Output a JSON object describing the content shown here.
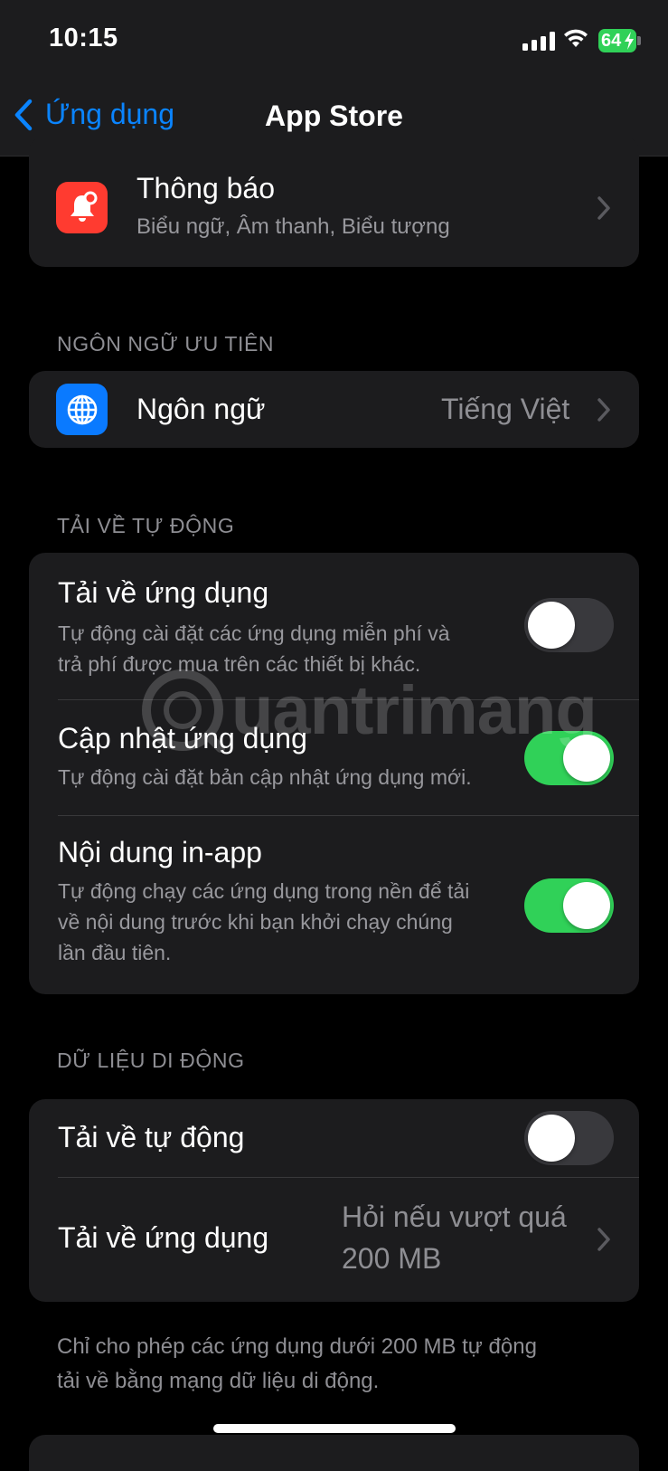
{
  "status_bar": {
    "time": "10:15",
    "battery": "64"
  },
  "nav": {
    "back_label": "Ứng dụng",
    "title": "App Store"
  },
  "notifications_row": {
    "title": "Thông báo",
    "subtitle": "Biểu ngữ, Âm thanh, Biểu tượng"
  },
  "language_section": {
    "header": "NGÔN NGỮ ƯU TIÊN",
    "row": {
      "title": "Ngôn ngữ",
      "value": "Tiếng Việt"
    }
  },
  "auto_download_section": {
    "header": "TẢI VỀ TỰ ĐỘNG",
    "rows": [
      {
        "title": "Tải về ứng dụng",
        "subtitle_lines": [
          "Tự động cài đặt các ứng dụng miễn phí và",
          "trả phí được mua trên các thiết bị khác."
        ],
        "on": false
      },
      {
        "title": "Cập nhật ứng dụng",
        "subtitle_lines": [
          "Tự động cài đặt bản cập nhật ứng dụng mới."
        ],
        "on": true
      },
      {
        "title": "Nội dung in-app",
        "subtitle_lines": [
          "Tự động chạy các ứng dụng trong nền để tải",
          "về nội dung trước khi bạn khởi chạy chúng",
          "lần đầu tiên."
        ],
        "on": true
      }
    ]
  },
  "cellular_section": {
    "header": "DỮ LIỆU DI ĐỘNG",
    "auto_download": {
      "title": "Tải về tự động",
      "on": false
    },
    "app_downloads": {
      "title": "Tải về ứng dụng",
      "value_lines": [
        "Hỏi nếu vượt quá",
        "200 MB"
      ]
    },
    "footer_lines": [
      "Chỉ cho phép các ứng dụng dưới 200 MB tự động",
      "tải về bằng mạng dữ liệu di động."
    ]
  },
  "watermark": {
    "text": "uantrimang"
  },
  "colors": {
    "accent": "#0a84ff",
    "toggle_on": "#30d158",
    "notification_icon": "#ff3b30",
    "language_icon": "#0a7aff"
  },
  "icons": [
    "chevron-left-icon",
    "bell-badge-icon",
    "globe-icon",
    "chevron-right-icon",
    "cellular-signal-icon",
    "wifi-icon",
    "battery-charging-icon"
  ]
}
